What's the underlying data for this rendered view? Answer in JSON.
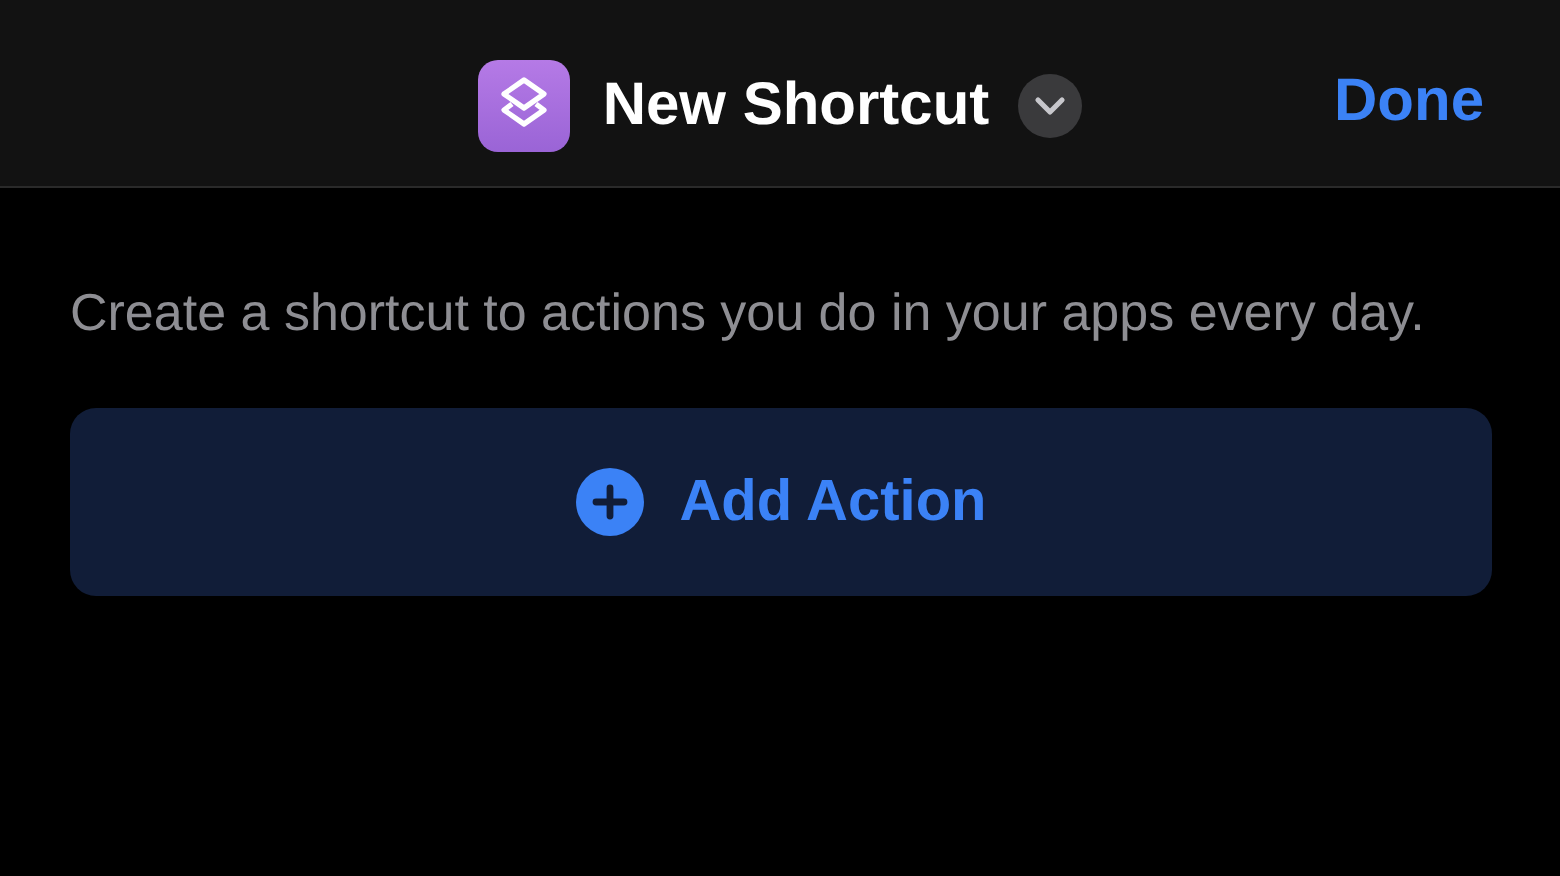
{
  "header": {
    "title": "New Shortcut",
    "done": "Done"
  },
  "description": "Create a shortcut to actions you do in your apps every day.",
  "add_action": {
    "label": "Add Action"
  }
}
